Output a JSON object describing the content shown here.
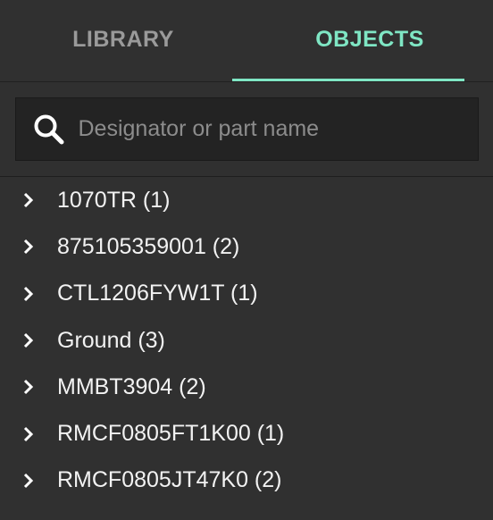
{
  "tabs": [
    {
      "label": "LIBRARY",
      "active": false
    },
    {
      "label": "OBJECTS",
      "active": true
    }
  ],
  "search": {
    "placeholder": "Designator or part name",
    "value": "",
    "icon": "search-icon"
  },
  "tree": {
    "items": [
      {
        "label": "1070TR (1)",
        "icon": "chevron-right-icon"
      },
      {
        "label": "875105359001 (2)",
        "icon": "chevron-right-icon"
      },
      {
        "label": "CTL1206FYW1T (1)",
        "icon": "chevron-right-icon"
      },
      {
        "label": "Ground (3)",
        "icon": "chevron-right-icon"
      },
      {
        "label": "MMBT3904 (2)",
        "icon": "chevron-right-icon"
      },
      {
        "label": "RMCF0805FT1K00 (1)",
        "icon": "chevron-right-icon"
      },
      {
        "label": "RMCF0805JT47K0 (2)",
        "icon": "chevron-right-icon"
      }
    ]
  },
  "colors": {
    "background": "#303030",
    "accent": "#7fe6c4",
    "inactive_tab": "#9a9a9a",
    "search_bg": "#232323",
    "text": "#f2f2f2",
    "placeholder": "#8c8c8c"
  }
}
